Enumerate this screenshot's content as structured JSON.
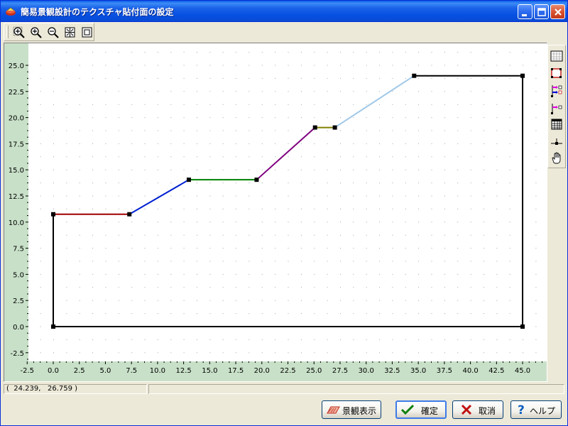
{
  "window": {
    "title": "簡易景観設計のテクスチャ貼付面の設定"
  },
  "status": {
    "coords": "(  24.239,   26.759 )",
    "extra": ""
  },
  "buttons": {
    "view_label": "景観表示",
    "ok_label": "確定",
    "cancel_label": "取消",
    "help_label": "ヘルプ"
  },
  "icons": {
    "toolbar": [
      "zoom-area-icon",
      "zoom-in-icon",
      "zoom-out-icon",
      "fit-all-icon",
      "fit-window-icon"
    ],
    "vertical_toolbar": [
      "grid-toggle-icon",
      "select-rect-icon",
      "point-move-icon",
      "point-add-icon",
      "table-icon",
      "snap-icon",
      "pan-hand-icon"
    ]
  },
  "colors": {
    "plot_background": "#FFFFFF",
    "axis_strip": "#C8E0C8",
    "title_bar": "#0A5CE6"
  },
  "chart_data": {
    "type": "line",
    "xlim": [
      -2.5,
      45.0
    ],
    "ylim": [
      -2.5,
      25.0
    ],
    "x_ticks": [
      "-2.5",
      "0.0",
      "2.5",
      "5.0",
      "7.5",
      "10.0",
      "12.5",
      "15.0",
      "17.5",
      "20.0",
      "22.5",
      "25.0",
      "27.5",
      "30.0",
      "32.5",
      "35.0",
      "37.5",
      "40.0",
      "42.5",
      "45.0"
    ],
    "y_ticks": [
      "25.0",
      "22.5",
      "20.0",
      "17.5",
      "15.0",
      "12.5",
      "10.0",
      "7.5",
      "5.0",
      "2.5",
      "0.0",
      "-2.5"
    ],
    "grid": true,
    "segments": [
      {
        "color": "#000000",
        "from": [
          0.0,
          0.0
        ],
        "to": [
          0.0,
          10.75
        ]
      },
      {
        "color": "#A00000",
        "from": [
          0.0,
          10.75
        ],
        "to": [
          7.3,
          10.75
        ]
      },
      {
        "color": "#0020D0",
        "from": [
          7.3,
          10.75
        ],
        "to": [
          13.0,
          14.05
        ]
      },
      {
        "color": "#008000",
        "from": [
          13.0,
          14.05
        ],
        "to": [
          19.5,
          14.05
        ]
      },
      {
        "color": "#800080",
        "from": [
          19.5,
          14.05
        ],
        "to": [
          25.1,
          19.05
        ]
      },
      {
        "color": "#808000",
        "from": [
          25.1,
          19.05
        ],
        "to": [
          27.0,
          19.05
        ]
      },
      {
        "color": "#A0C8E8",
        "from": [
          27.0,
          19.05
        ],
        "to": [
          34.6,
          24.0
        ]
      },
      {
        "color": "#000000",
        "from": [
          34.6,
          24.0
        ],
        "to": [
          45.0,
          24.0
        ]
      },
      {
        "color": "#000000",
        "from": [
          45.0,
          24.0
        ],
        "to": [
          45.0,
          0.0
        ]
      },
      {
        "color": "#000000",
        "from": [
          45.0,
          0.0
        ],
        "to": [
          0.0,
          0.0
        ]
      }
    ],
    "points": [
      [
        0.0,
        0.0
      ],
      [
        0.0,
        10.75
      ],
      [
        7.3,
        10.75
      ],
      [
        13.0,
        14.05
      ],
      [
        19.5,
        14.05
      ],
      [
        25.1,
        19.05
      ],
      [
        27.0,
        19.05
      ],
      [
        34.6,
        24.0
      ],
      [
        45.0,
        24.0
      ],
      [
        45.0,
        0.0
      ]
    ]
  }
}
